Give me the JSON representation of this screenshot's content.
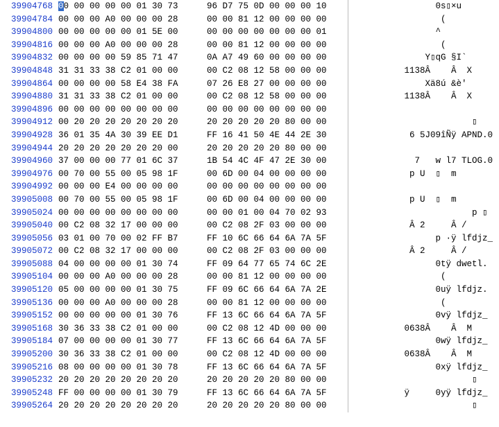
{
  "rows": [
    {
      "offset": "39904768",
      "hexL": "00 00 00 00 00 01 30 73",
      "hexR": "96 D7 75 0D 00 00 00 10",
      "ascii": "      0s▯×u      ",
      "cursor": true
    },
    {
      "offset": "39904784",
      "hexL": "00 00 00 A0 00 00 00 28",
      "hexR": "00 00 81 12 00 00 00 00",
      "ascii": "       (         "
    },
    {
      "offset": "39904800",
      "hexL": "00 00 00 00 00 01 5E 00",
      "hexR": "00 00 00 00 00 00 00 01",
      "ascii": "      ^          "
    },
    {
      "offset": "39904816",
      "hexL": "00 00 00 A0 00 00 00 28",
      "hexR": "00 00 81 12 00 00 00 00",
      "ascii": "       (         "
    },
    {
      "offset": "39904832",
      "hexL": "00 00 00 00 59 85 71 47",
      "hexR": "0A A7 49 60 00 00 00 00",
      "ascii": "    Y▯qG §I`     "
    },
    {
      "offset": "39904848",
      "hexL": "31 31 33 38 C2 01 00 00",
      "hexR": "00 C2 08 12 58 00 00 00",
      "ascii": "1138Â    Â  X    "
    },
    {
      "offset": "39904864",
      "hexL": "00 00 00 00 58 E4 38 FA",
      "hexR": "07 26 E8 27 00 00 00 00",
      "ascii": "    Xä8ú &è'     "
    },
    {
      "offset": "39904880",
      "hexL": "31 31 33 38 C2 01 00 00",
      "hexR": "00 C2 08 12 58 00 00 00",
      "ascii": "1138Â    Â  X    "
    },
    {
      "offset": "39904896",
      "hexL": "00 00 00 00 00 00 00 00",
      "hexR": "00 00 00 00 00 00 00 00",
      "ascii": "                 "
    },
    {
      "offset": "39904912",
      "hexL": "00 20 20 20 20 20 20 20",
      "hexR": "20 20 20 20 20 80 00 00",
      "ascii": "             ▯   "
    },
    {
      "offset": "39904928",
      "hexL": "36 01 35 4A 30 39 EE D1",
      "hexR": "FF 16 41 50 4E 44 2E 30",
      "ascii": "6 5J09îÑÿ APND.0"
    },
    {
      "offset": "39904944",
      "hexL": "20 20 20 20 20 20 20 00",
      "hexR": "20 20 20 20 20 80 00 00",
      "ascii": "                 "
    },
    {
      "offset": "39904960",
      "hexL": "37 00 00 00 77 01 6C 37",
      "hexR": "1B 54 4C 4F 47 2E 30 00",
      "ascii": "7   w l7 TLOG.0"
    },
    {
      "offset": "39904976",
      "hexL": "00 70 00 55 00 05 98 1F",
      "hexR": "00 6D 00 04 00 00 00 00",
      "ascii": " p U  ▯  m       "
    },
    {
      "offset": "39904992",
      "hexL": "00 00 00 E4 00 00 00 00",
      "hexR": "00 00 00 00 00 00 00 00",
      "ascii": "                 "
    },
    {
      "offset": "39905008",
      "hexL": "00 70 00 55 00 05 98 1F",
      "hexR": "00 6D 00 04 00 00 00 00",
      "ascii": " p U  ▯  m       "
    },
    {
      "offset": "39905024",
      "hexL": "00 00 00 00 00 00 00 00",
      "hexR": "00 00 01 00 04 70 02 93",
      "ascii": "             p ▯ "
    },
    {
      "offset": "39905040",
      "hexL": "00 C2 08 32 17 00 00 00",
      "hexR": "00 C2 08 2F 03 00 00 00",
      "ascii": " Â 2     Â /     "
    },
    {
      "offset": "39905056",
      "hexL": "03 01 00 70 00 02 FF B7",
      "hexR": "FF 10 6C 66 64 6A 7A 5F",
      "ascii": "   p ·ÿ lfdjz_"
    },
    {
      "offset": "39905072",
      "hexL": "00 C2 08 32 17 00 00 00",
      "hexR": "00 C2 08 2F 03 00 00 00",
      "ascii": " Â 2     Â /     "
    },
    {
      "offset": "39905088",
      "hexL": "04 00 00 00 00 01 30 74",
      "hexR": "FF 09 64 77 65 74 6C 2E",
      "ascii": "      0tÿ dwetl. "
    },
    {
      "offset": "39905104",
      "hexL": "00 00 00 A0 00 00 00 28",
      "hexR": "00 00 81 12 00 00 00 00",
      "ascii": "       (         "
    },
    {
      "offset": "39905120",
      "hexL": "05 00 00 00 00 01 30 75",
      "hexR": "FF 09 6C 66 64 6A 7A 2E",
      "ascii": "      0uÿ lfdjz. "
    },
    {
      "offset": "39905136",
      "hexL": "00 00 00 A0 00 00 00 28",
      "hexR": "00 00 81 12 00 00 00 00",
      "ascii": "       (         "
    },
    {
      "offset": "39905152",
      "hexL": "00 00 00 00 00 01 30 76",
      "hexR": "FF 13 6C 66 64 6A 7A 5F",
      "ascii": "      0vÿ lfdjz_ "
    },
    {
      "offset": "39905168",
      "hexL": "30 36 33 38 C2 01 00 00",
      "hexR": "00 C2 08 12 4D 00 00 00",
      "ascii": "0638Â    Â  M    "
    },
    {
      "offset": "39905184",
      "hexL": "07 00 00 00 00 01 30 77",
      "hexR": "FF 13 6C 66 64 6A 7A 5F",
      "ascii": "      0wÿ lfdjz_ "
    },
    {
      "offset": "39905200",
      "hexL": "30 36 33 38 C2 01 00 00",
      "hexR": "00 C2 08 12 4D 00 00 00",
      "ascii": "0638Â    Â  M    "
    },
    {
      "offset": "39905216",
      "hexL": "08 00 00 00 00 01 30 78",
      "hexR": "FF 13 6C 66 64 6A 7A 5F",
      "ascii": "      0xÿ lfdjz_ "
    },
    {
      "offset": "39905232",
      "hexL": "20 20 20 20 20 20 20 20",
      "hexR": "20 20 20 20 20 80 00 00",
      "ascii": "             ▯   "
    },
    {
      "offset": "39905248",
      "hexL": "FF 00 00 00 00 01 30 79",
      "hexR": "FF 13 6C 66 64 6A 7A 5F",
      "ascii": "ÿ     0yÿ lfdjz_ "
    },
    {
      "offset": "39905264",
      "hexL": "20 20 20 20 20 20 20 20",
      "hexR": "20 20 20 20 20 80 00 00",
      "ascii": "             ▯   "
    }
  ]
}
